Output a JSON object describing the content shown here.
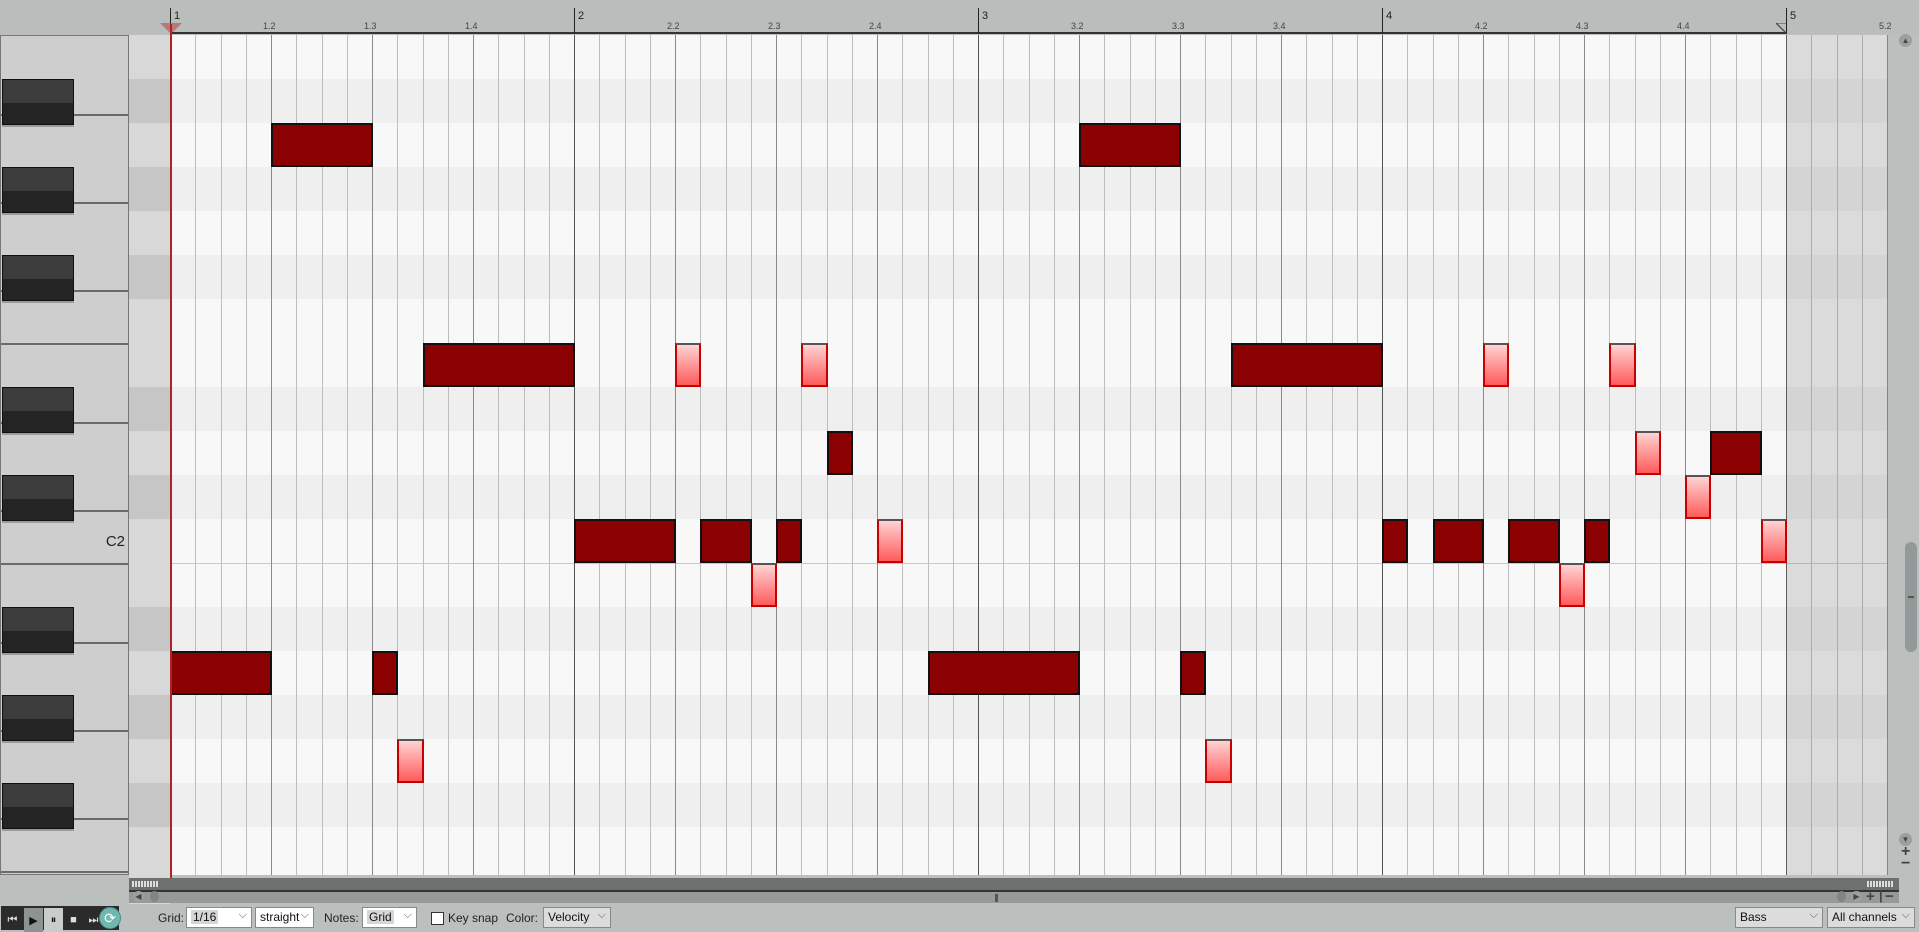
{
  "ruler": {
    "bars": [
      "1",
      "2",
      "3",
      "4",
      "5"
    ],
    "beats": [
      [
        "1.2",
        "1.3",
        "1.4"
      ],
      [
        "2.2",
        "2.3",
        "2.4"
      ],
      [
        "3.2",
        "3.3",
        "3.4"
      ],
      [
        "4.2",
        "4.3",
        "4.4"
      ],
      [
        "5.2"
      ]
    ]
  },
  "keyboard": {
    "label": "C2",
    "rows": [
      "B2",
      "A#2",
      "A2",
      "G#2",
      "G2",
      "F#2",
      "F2",
      "E2",
      "D#2",
      "D2",
      "C#2",
      "C2",
      "B1",
      "A#1",
      "A1",
      "G#1",
      "G1",
      "F#1",
      "F1",
      "E1"
    ]
  },
  "grid": {
    "bars": 4,
    "sixteenths_per_bar": 16,
    "extra_sixteenths_after_end": 4
  },
  "notes": [
    {
      "pitch": "A2",
      "start": 4,
      "length": 4,
      "velocity": "high"
    },
    {
      "pitch": "A2",
      "start": 36,
      "length": 4,
      "velocity": "high"
    },
    {
      "pitch": "E2",
      "start": 10,
      "length": 6,
      "velocity": "high"
    },
    {
      "pitch": "E2",
      "start": 20,
      "length": 1,
      "velocity": "low"
    },
    {
      "pitch": "E2",
      "start": 25,
      "length": 1,
      "velocity": "low"
    },
    {
      "pitch": "E2",
      "start": 42,
      "length": 6,
      "velocity": "high"
    },
    {
      "pitch": "E2",
      "start": 52,
      "length": 1,
      "velocity": "low"
    },
    {
      "pitch": "E2",
      "start": 57,
      "length": 1,
      "velocity": "low"
    },
    {
      "pitch": "D2",
      "start": 26,
      "length": 1,
      "velocity": "high"
    },
    {
      "pitch": "D2",
      "start": 58,
      "length": 1,
      "velocity": "low"
    },
    {
      "pitch": "D2",
      "start": 61,
      "length": 2,
      "velocity": "high"
    },
    {
      "pitch": "C#2",
      "start": 60,
      "length": 1,
      "velocity": "low"
    },
    {
      "pitch": "C2",
      "start": 16,
      "length": 4,
      "velocity": "high"
    },
    {
      "pitch": "C2",
      "start": 21,
      "length": 2,
      "velocity": "high"
    },
    {
      "pitch": "C2",
      "start": 24,
      "length": 1,
      "velocity": "high"
    },
    {
      "pitch": "C2",
      "start": 28,
      "length": 1,
      "velocity": "low"
    },
    {
      "pitch": "C2",
      "start": 48,
      "length": 1,
      "velocity": "high"
    },
    {
      "pitch": "C2",
      "start": 50,
      "length": 2,
      "velocity": "high"
    },
    {
      "pitch": "C2",
      "start": 53,
      "length": 2,
      "velocity": "high"
    },
    {
      "pitch": "C2",
      "start": 56,
      "length": 1,
      "velocity": "high"
    },
    {
      "pitch": "C2",
      "start": 63,
      "length": 1,
      "velocity": "low"
    },
    {
      "pitch": "B1",
      "start": 23,
      "length": 1,
      "velocity": "low"
    },
    {
      "pitch": "B1",
      "start": 55,
      "length": 1,
      "velocity": "low"
    },
    {
      "pitch": "A1",
      "start": 0,
      "length": 4,
      "velocity": "high"
    },
    {
      "pitch": "A1",
      "start": 8,
      "length": 1,
      "velocity": "high"
    },
    {
      "pitch": "A1",
      "start": 30,
      "length": 6,
      "velocity": "high"
    },
    {
      "pitch": "A1",
      "start": 40,
      "length": 1,
      "velocity": "high"
    },
    {
      "pitch": "G1",
      "start": 9,
      "length": 1,
      "velocity": "low"
    },
    {
      "pitch": "G1",
      "start": 41,
      "length": 1,
      "velocity": "low"
    }
  ],
  "colors": {
    "note_high_velocity": "#8b0000",
    "note_low_velocity_top": "#ffd2d2",
    "note_low_velocity_bottom": "#ff5c5c",
    "playhead": "#b22222",
    "loop_button": "#6fb8b0"
  },
  "toolbar": {
    "transport": {
      "skip_back": "⏮",
      "play": "▶",
      "pause": "⏸",
      "stop": "■",
      "skip_forward": "⏭"
    },
    "grid_label": "Grid:",
    "grid_value": "1/16",
    "grid_mode": "straight",
    "notes_label": "Notes:",
    "notes_value": "Grid",
    "key_snap_label": "Key snap",
    "key_snap_checked": false,
    "color_label": "Color:",
    "color_value": "Velocity",
    "track_value": "Bass",
    "channel_value": "All channels"
  }
}
